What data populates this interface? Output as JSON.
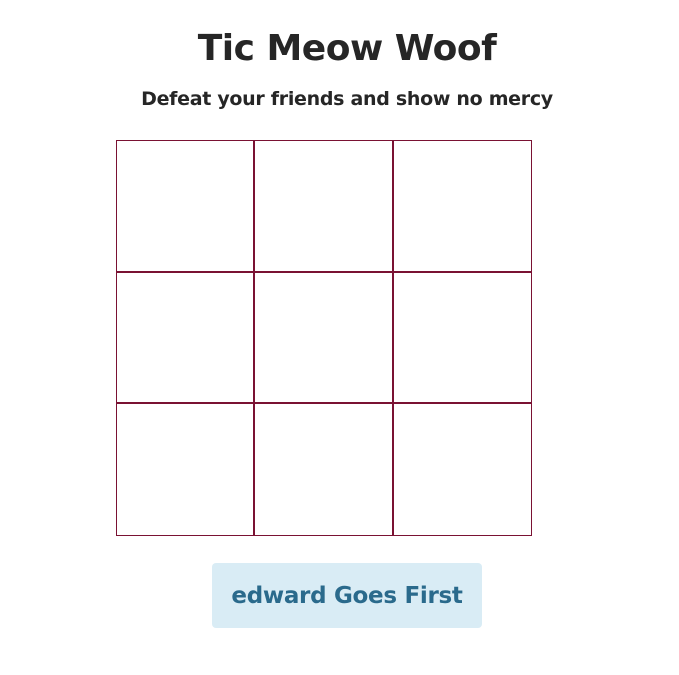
{
  "header": {
    "title": "Tic Meow Woof",
    "subtitle": "Defeat your friends and show no mercy"
  },
  "board": {
    "cells": [
      "",
      "",
      "",
      "",
      "",
      "",
      "",
      "",
      ""
    ]
  },
  "status": {
    "label": "edward Goes First"
  },
  "colors": {
    "grid_line": "#7a1233",
    "button_bg": "#d9ecf5",
    "button_text": "#2a6a8c",
    "text": "#262626"
  }
}
